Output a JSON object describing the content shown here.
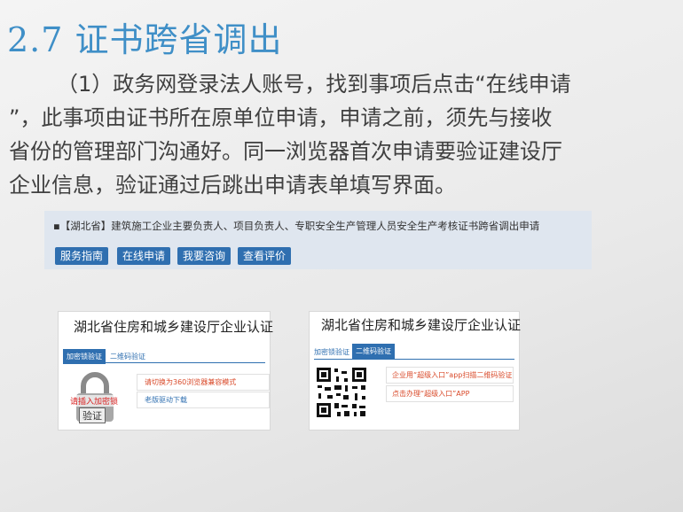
{
  "title": "2.7  证书跨省调出",
  "paragraph": [
    "（1）政务网登录法人账号，找到事项后点击“在线申请",
    "”，此事项由证书所在原单位申请，申请之前，须先与接收",
    "省份的管理部门沟通好。同一浏览器首次申请要验证建设厅",
    "企业信息，验证通过后跳出申请表单填写界面。"
  ],
  "service": {
    "title": "▪【湖北省】建筑施工企业主要负责人、项目负责人、专职安全生产管理人员安全生产考核证书跨省调出申请",
    "buttons": [
      "服务指南",
      "在线申请",
      "我要咨询",
      "查看评价"
    ]
  },
  "cert_left": {
    "title": "湖北省住房和城乡建设厅企业认证",
    "tabs": [
      "加密锁验证",
      "二维码验证"
    ],
    "options": [
      "请切换为360浏览器兼容模式",
      "老版驱动下载"
    ],
    "lock_text": "请插入加密锁",
    "verify_text": "验证"
  },
  "cert_right": {
    "title": "湖北省住房和城乡建设厅企业认证",
    "tabs": [
      "加密锁验证",
      "二维码验证"
    ],
    "options": [
      "企业用“超级入口”app扫描二维码验证",
      "点击办理“超级入口”APP"
    ]
  },
  "colors": {
    "accent": "#3f8fc7",
    "button": "#2f6fb0"
  }
}
